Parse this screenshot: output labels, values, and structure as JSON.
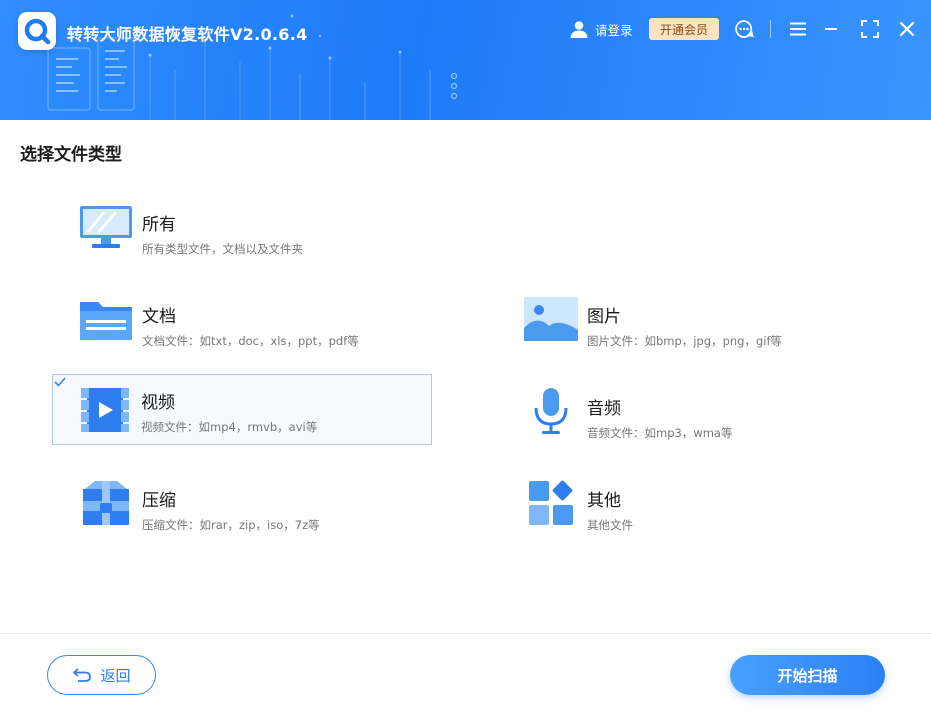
{
  "header": {
    "app_title": "转转大师数据恢复软件V2.0.6.4",
    "login_label": "请登录",
    "vip_label": "开通会员"
  },
  "main": {
    "section_title": "选择文件类型",
    "file_types": [
      {
        "name": "所有",
        "desc": "所有类型文件，文档以及文件夹",
        "icon": "monitor-icon",
        "selected": false
      },
      {
        "name": "文档",
        "desc": "文档文件：如txt，doc，xls，ppt，pdf等",
        "icon": "folder-icon",
        "selected": false
      },
      {
        "name": "图片",
        "desc": "图片文件：如bmp，jpg，png，gif等",
        "icon": "image-icon",
        "selected": false
      },
      {
        "name": "视频",
        "desc": "视频文件：如mp4，rmvb，avi等",
        "icon": "video-icon",
        "selected": true
      },
      {
        "name": "音频",
        "desc": "音频文件：如mp3，wma等",
        "icon": "microphone-icon",
        "selected": false
      },
      {
        "name": "压缩",
        "desc": "压缩文件：如rar，zip，iso，7z等",
        "icon": "archive-icon",
        "selected": false
      },
      {
        "name": "其他",
        "desc": "其他文件",
        "icon": "apps-icon",
        "selected": false
      }
    ]
  },
  "footer": {
    "back_label": "返回",
    "start_label": "开始扫描"
  },
  "colors": {
    "header_blue": "#1e7bf7",
    "accent": "#2f7ef0",
    "vip_bg": "#ffe2c2"
  }
}
